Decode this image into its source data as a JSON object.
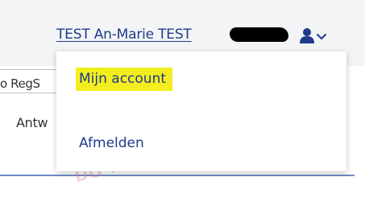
{
  "header": {
    "user_name": "TEST An-Marie TEST",
    "icons": {
      "user": "user-icon",
      "chevron": "chevron-down-icon"
    }
  },
  "background": {
    "search_text": "o RegS",
    "tab_text": "Antw",
    "watermark": "DO NOT USE"
  },
  "menu": {
    "items": [
      {
        "label": "Mijn account",
        "highlight_color": "#f4ee1e"
      },
      {
        "label": "Afmelden"
      }
    ]
  },
  "colors": {
    "link": "#1f3b8c",
    "header_bg": "#f2f4f5",
    "divider": "#6d8bc7"
  }
}
